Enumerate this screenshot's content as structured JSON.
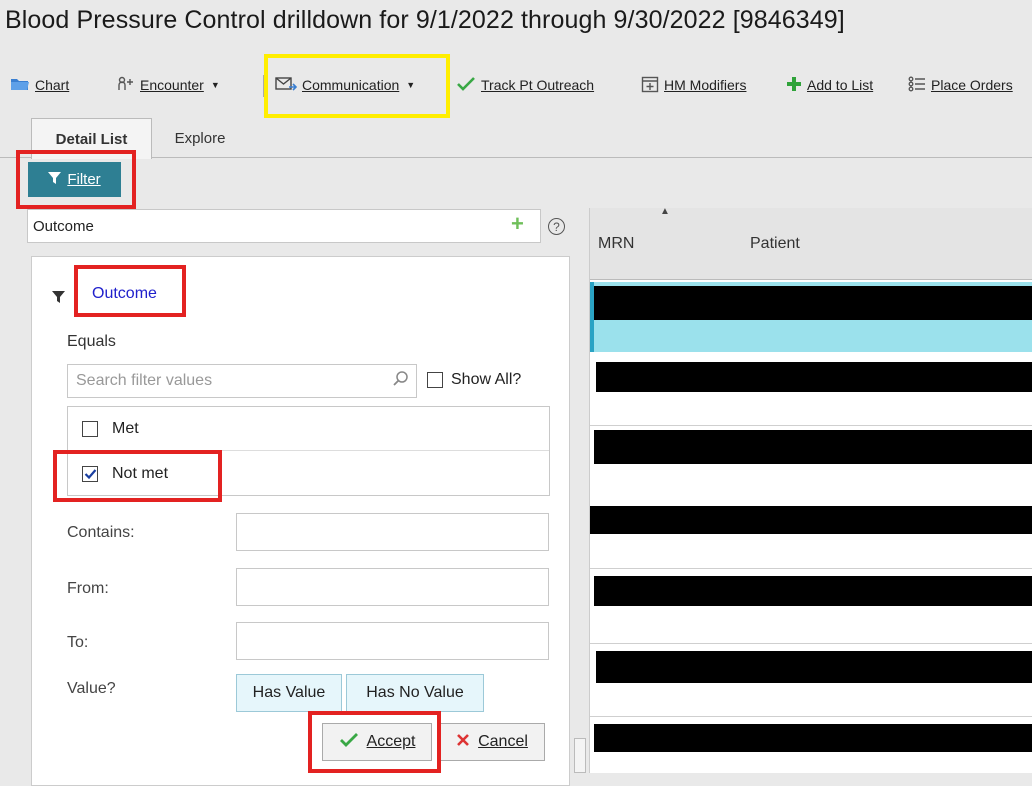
{
  "page_title": "Blood Pressure Control drilldown for 9/1/2022 through 9/30/2022 [9846349]",
  "toolbar": {
    "chart": {
      "label": "Chart",
      "icon": "folder-icon"
    },
    "encounter": {
      "label": "Encounter",
      "icon": "person-icon"
    },
    "communication": {
      "label": "Communication",
      "icon": "envelope-icon"
    },
    "track_pt_outreach": {
      "label": "Track Pt Outreach",
      "icon": "checkmark-icon"
    },
    "hm_modifiers": {
      "label": "HM Modifiers",
      "icon": "calendar-plus-icon"
    },
    "add_to_list": {
      "label": "Add to List",
      "icon": "green-plus-icon"
    },
    "place_orders": {
      "label": "Place Orders",
      "icon": "list-icon"
    }
  },
  "tabs": [
    {
      "label": "Detail List",
      "active": true
    },
    {
      "label": "Explore",
      "active": false
    }
  ],
  "filter_button": {
    "label": "Filter"
  },
  "outcome_selector": {
    "value": "Outcome"
  },
  "filter_panel": {
    "column_name": "Outcome",
    "operator_label": "Equals",
    "search_placeholder": "Search filter values",
    "show_all_label": "Show All?",
    "show_all_checked": false,
    "values": [
      {
        "label": "Met",
        "checked": false
      },
      {
        "label": "Not met",
        "checked": true
      }
    ],
    "contains_label": "Contains:",
    "from_label": "From:",
    "to_label": "To:",
    "value_label": "Value?",
    "has_value_label": "Has Value",
    "has_no_value_label": "Has No Value",
    "accept_label": "Accept",
    "cancel_label": "Cancel"
  },
  "grid": {
    "columns": [
      "MRN",
      "Patient"
    ]
  },
  "colors": {
    "filter_button_bg": "#2e7f93",
    "selected_row": "#9be1ec",
    "highlight_red": "#e32221",
    "highlight_yellow": "#ffee00",
    "link_blue": "#2020cc"
  }
}
